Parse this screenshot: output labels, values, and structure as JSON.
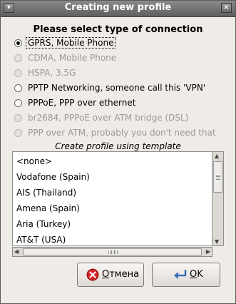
{
  "window": {
    "title": "Creating new profile"
  },
  "connection_heading": "Please select type of connection",
  "connection_types": [
    {
      "label": "GPRS, Mobile Phone",
      "selected": true,
      "enabled": true
    },
    {
      "label": "CDMA, Mobile Phone",
      "selected": false,
      "enabled": false
    },
    {
      "label": "HSPA, 3.5G",
      "selected": false,
      "enabled": false
    },
    {
      "label": "PPTP Networking, someone call this 'VPN'",
      "selected": false,
      "enabled": true
    },
    {
      "label": "PPPoE, PPP over ethernet",
      "selected": false,
      "enabled": true
    },
    {
      "label": "br2684, PPPoE over ATM bridge (DSL)",
      "selected": false,
      "enabled": false
    },
    {
      "label": "PPP over ATM, probably you don't need that",
      "selected": false,
      "enabled": false
    }
  ],
  "template": {
    "caption": "Create profile using template",
    "items": [
      "<none>",
      "Vodafone (Spain)",
      "AIS (Thailand)",
      "Amena (Spain)",
      "Aria (Turkey)",
      "AT&T (USA)"
    ]
  },
  "buttons": {
    "cancel": {
      "mnemonic": "О",
      "rest": "тмена",
      "icon": "cancel-icon"
    },
    "ok": {
      "mnemonic": "O",
      "rest": "K",
      "icon": "ok-return-icon"
    }
  },
  "colors": {
    "titlebar": "#6f6f6f",
    "window_bg": "#efebe7",
    "cancel_icon": "#d42020",
    "ok_icon": "#3a6fb5"
  }
}
